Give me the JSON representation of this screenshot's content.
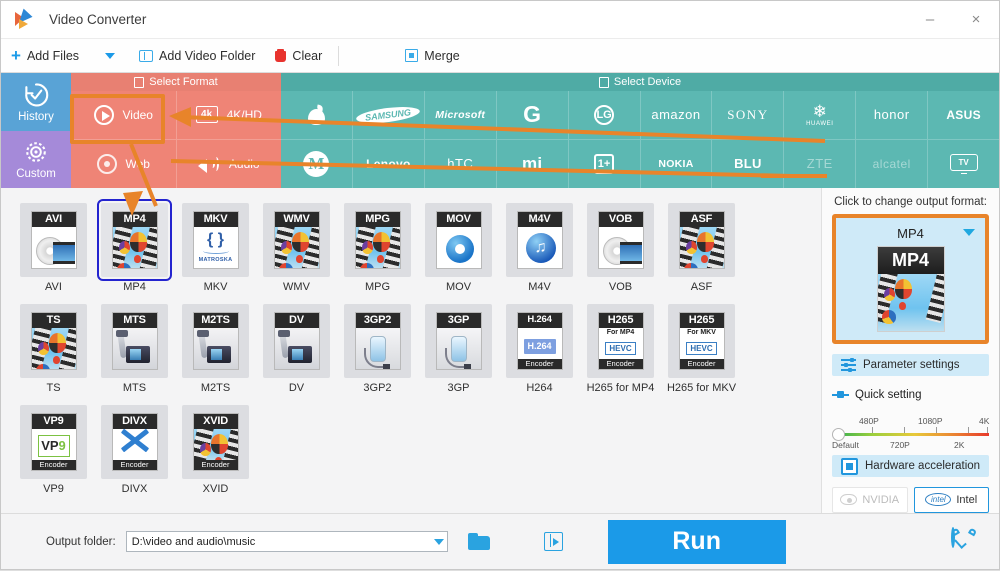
{
  "window": {
    "title": "Video Converter",
    "minimize_label": "–",
    "close_label": "×"
  },
  "toolbar": {
    "add_files": "Add Files",
    "add_video_folder": "Add Video Folder",
    "clear": "Clear",
    "merge": "Merge"
  },
  "sidebar": {
    "items": [
      {
        "label": "History",
        "color": "#59a3d6"
      },
      {
        "label": "Custom",
        "color": "#a58ad9"
      }
    ]
  },
  "format_band": {
    "header": "Select Format",
    "color": "#ef8476",
    "cells": [
      {
        "label": "Video",
        "icon": "play-circle-icon",
        "selected": true
      },
      {
        "label": "4K/HD",
        "icon": "fourk-icon",
        "selected": false
      },
      {
        "label": "Web",
        "icon": "globe-icon",
        "selected": false
      },
      {
        "label": "Audio",
        "icon": "speaker-icon",
        "selected": false
      }
    ]
  },
  "device_band": {
    "header": "Select Device",
    "color": "#5cb8b2",
    "row1": [
      "Apple",
      "SAMSUNG",
      "Microsoft",
      "G",
      "LG",
      "amazon",
      "SONY",
      "HUAWEI",
      "honor",
      "ASUS"
    ],
    "row2": [
      "Motorola",
      "Lenovo",
      "hTC",
      "mi",
      "1+",
      "NOKIA",
      "BLU",
      "ZTE",
      "alcatel",
      "TV"
    ]
  },
  "formats": {
    "tiles": [
      {
        "label": "AVI",
        "cap": "AVI",
        "art": "cd",
        "selected": false
      },
      {
        "label": "MP4",
        "cap": "MP4",
        "art": "balloon",
        "selected": true
      },
      {
        "label": "MKV",
        "cap": "MKV",
        "art": "mkv",
        "selected": false
      },
      {
        "label": "WMV",
        "cap": "WMV",
        "art": "balloon",
        "selected": false
      },
      {
        "label": "MPG",
        "cap": "MPG",
        "art": "balloon",
        "selected": false
      },
      {
        "label": "MOV",
        "cap": "MOV",
        "art": "quicktime",
        "selected": false
      },
      {
        "label": "M4V",
        "cap": "M4V",
        "art": "itunes",
        "selected": false
      },
      {
        "label": "VOB",
        "cap": "VOB",
        "art": "cd",
        "selected": false
      },
      {
        "label": "ASF",
        "cap": "ASF",
        "art": "balloon",
        "selected": false
      },
      {
        "label": "TS",
        "cap": "TS",
        "art": "balloon",
        "selected": false
      },
      {
        "label": "MTS",
        "cap": "MTS",
        "art": "camcorder",
        "selected": false
      },
      {
        "label": "M2TS",
        "cap": "M2TS",
        "art": "camcorder",
        "selected": false
      },
      {
        "label": "DV",
        "cap": "DV",
        "art": "camcorder",
        "selected": false
      },
      {
        "label": "3GP2",
        "cap": "3GP2",
        "art": "mp3player",
        "selected": false
      },
      {
        "label": "3GP",
        "cap": "3GP",
        "art": "mp3player",
        "selected": false
      },
      {
        "label": "H264",
        "cap": "H.264",
        "art": "h264",
        "sub": "",
        "foot": "Encoder",
        "selected": false
      },
      {
        "label": "H265 for MP4",
        "cap": "H265",
        "art": "hevc",
        "sub": "For MP4",
        "foot": "Encoder",
        "selected": false
      },
      {
        "label": "H265 for MKV",
        "cap": "H265",
        "art": "hevc",
        "sub": "For MKV",
        "foot": "Encoder",
        "selected": false
      },
      {
        "label": "VP9",
        "cap": "VP9",
        "art": "vp9",
        "foot": "Encoder",
        "selected": false
      },
      {
        "label": "DIVX",
        "cap": "DIVX",
        "art": "divx",
        "foot": "Encoder",
        "selected": false
      },
      {
        "label": "XVID",
        "cap": "XVID",
        "art": "balloon",
        "foot": "Encoder",
        "selected": false
      }
    ]
  },
  "output_panel": {
    "title": "Click to change output format:",
    "format_name": "MP4",
    "thumb_cap": "MP4",
    "parameter_settings": "Parameter settings",
    "quick_setting": "Quick setting",
    "hardware_acceleration": "Hardware acceleration",
    "accel_nvidia": "NVIDIA",
    "accel_intel": "Intel",
    "slider": {
      "top_labels": [
        "480P",
        "1080P",
        "4K"
      ],
      "bottom_labels": [
        "Default",
        "720P",
        "2K"
      ],
      "value": "Default"
    },
    "highlight_color": "#e8842a"
  },
  "bottom_bar": {
    "output_folder_label": "Output folder:",
    "output_folder_path": "D:\\video and audio\\music",
    "run_label": "Run"
  }
}
